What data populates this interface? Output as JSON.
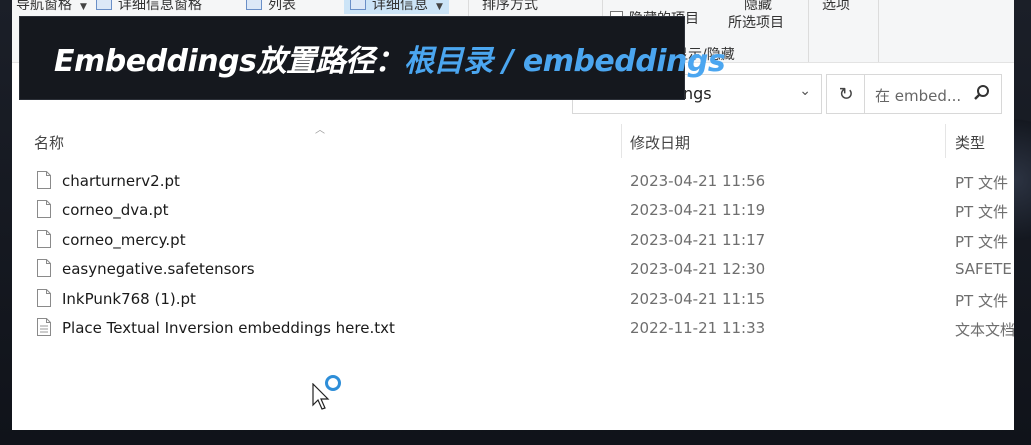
{
  "ribbon": {
    "nav_pane": "导航窗格",
    "details_pane": "详细信息窗格",
    "list": "列表",
    "details": "详细信息",
    "sort_by": "排序方式",
    "hidden_items": "隐藏的项目",
    "hide": "隐藏",
    "selected_items": "所选项目",
    "show_hide": "显示/隐藏",
    "options": "选项"
  },
  "address": {
    "path_tail": "ngs",
    "search_placeholder": "在 embed..."
  },
  "columns": {
    "name": "名称",
    "date": "修改日期",
    "type": "类型"
  },
  "files": [
    {
      "name": "charturnerv2.pt",
      "date": "2023-04-21 11:56",
      "type": "PT 文件"
    },
    {
      "name": "corneo_dva.pt",
      "date": "2023-04-21 11:19",
      "type": "PT 文件"
    },
    {
      "name": "corneo_mercy.pt",
      "date": "2023-04-21 11:17",
      "type": "PT 文件"
    },
    {
      "name": "easynegative.safetensors",
      "date": "2023-04-21 12:30",
      "type": "SAFETE"
    },
    {
      "name": "InkPunk768 (1).pt",
      "date": "2023-04-21 11:15",
      "type": "PT 文件"
    },
    {
      "name": "Place Textual Inversion embeddings here.txt",
      "date": "2022-11-21 11:33",
      "type": "文本文档"
    }
  ],
  "banner": {
    "label": "Embeddings放置路径：",
    "path": "根目录 / embeddings",
    "accent_color": "#4ba6f0"
  }
}
